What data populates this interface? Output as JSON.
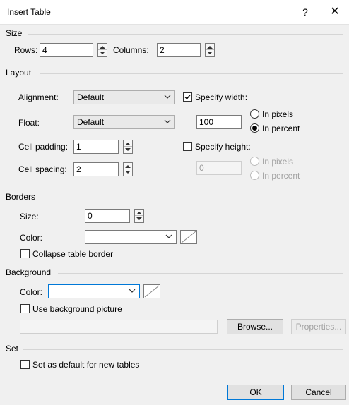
{
  "window": {
    "title": "Insert Table",
    "help_glyph": "?",
    "close_glyph": "✕"
  },
  "size": {
    "group": "Size",
    "rows_label": "Rows:",
    "rows_value": "4",
    "columns_label": "Columns:",
    "columns_value": "2"
  },
  "layout": {
    "group": "Layout",
    "alignment_label": "Alignment:",
    "alignment_value": "Default",
    "float_label": "Float:",
    "float_value": "Default",
    "cell_padding_label": "Cell padding:",
    "cell_padding_value": "1",
    "cell_spacing_label": "Cell spacing:",
    "cell_spacing_value": "2",
    "specify_width_label": "Specify width:",
    "specify_width_checked": true,
    "width_value": "100",
    "width_pixels_label": "In pixels",
    "width_percent_label": "In percent",
    "specify_height_label": "Specify height:",
    "specify_height_checked": false,
    "height_value": "0",
    "height_pixels_label": "In pixels",
    "height_percent_label": "In percent"
  },
  "borders": {
    "group": "Borders",
    "size_label": "Size:",
    "size_value": "0",
    "color_label": "Color:",
    "collapse_label": "Collapse table border"
  },
  "background": {
    "group": "Background",
    "color_label": "Color:",
    "use_picture_label": "Use background picture",
    "browse_label": "Browse...",
    "properties_label": "Properties..."
  },
  "set": {
    "group": "Set",
    "default_label": "Set as default for new tables"
  },
  "footer": {
    "ok_label": "OK",
    "cancel_label": "Cancel"
  }
}
